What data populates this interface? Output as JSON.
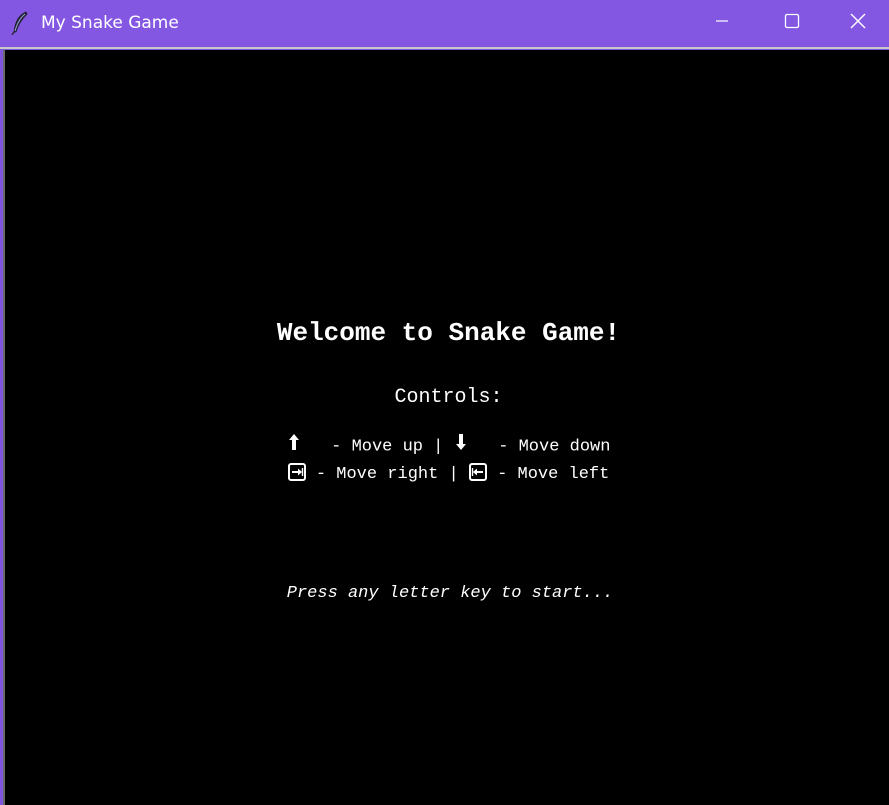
{
  "window": {
    "title": "My Snake Game",
    "accent_color": "#8457e3"
  },
  "titlebar_buttons": {
    "minimize_icon": "minimize-icon",
    "maximize_icon": "maximize-icon",
    "close_icon": "close-icon"
  },
  "game": {
    "welcome": "Welcome to Snake Game!",
    "controls_heading": "Controls:",
    "controls": {
      "up_icon": "arrow-up-icon",
      "up_label": " - Move up |",
      "down_icon": "arrow-down-icon",
      "down_label": " - Move down",
      "right_icon": "arrow-right-key-icon",
      "right_label": "- Move right |",
      "left_icon": "arrow-left-key-icon",
      "left_label": "- Move left"
    },
    "start_prompt": "Press any letter key to start..."
  }
}
